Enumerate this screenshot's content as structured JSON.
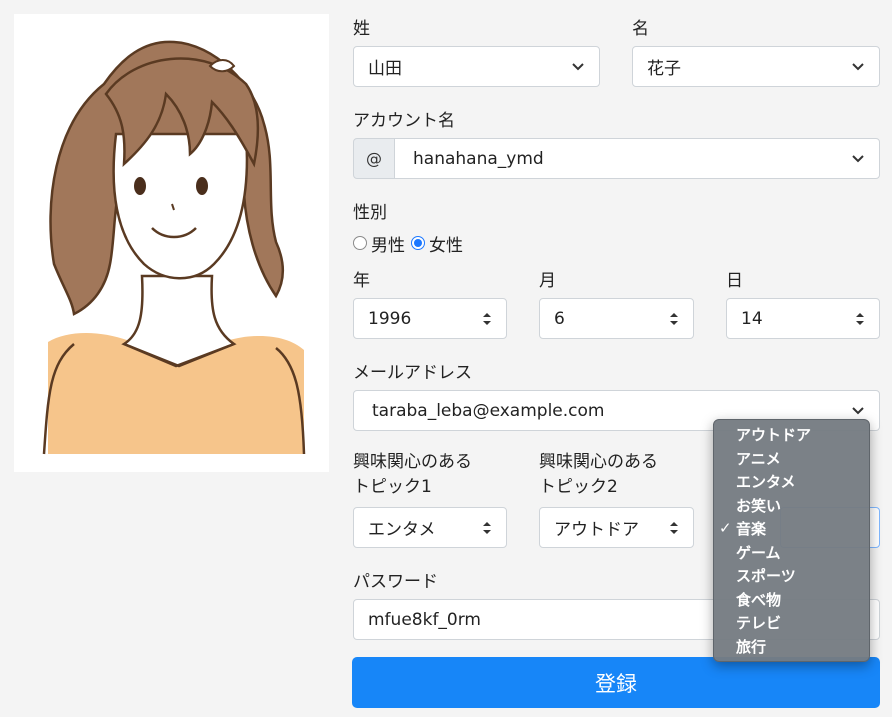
{
  "labels": {
    "last_name": "姓",
    "first_name": "名",
    "account": "アカウント名",
    "gender": "性別",
    "year": "年",
    "month": "月",
    "day": "日",
    "email": "メールアドレス",
    "topic1_line1": "興味関心のある",
    "topic1_line2": "トピック1",
    "topic2_line1": "興味関心のある",
    "topic2_line2": "トピック2",
    "password": "パスワード"
  },
  "fields": {
    "last_name": "山田",
    "first_name": "花子",
    "account_prefix": "@",
    "account": "hanahana_ymd",
    "year": "1996",
    "month": "6",
    "day": "14",
    "email": "taraba_leba@example.com",
    "topic1": "エンタメ",
    "topic2": "アウトドア",
    "password": "mfue8kf_0rm"
  },
  "gender": {
    "male": "男性",
    "female": "女性",
    "selected": "female"
  },
  "dropdown": {
    "items": [
      "アウトドア",
      "アニメ",
      "エンタメ",
      "お笑い",
      "音楽",
      "ゲーム",
      "スポーツ",
      "食べ物",
      "テレビ",
      "旅行"
    ],
    "selected": "音楽",
    "check": "✓"
  },
  "submit_label": "登録",
  "colors": {
    "accent": "#1786f8",
    "skin": "#ffffff",
    "hair": "#a1775a",
    "shirt": "#f6c58b"
  }
}
